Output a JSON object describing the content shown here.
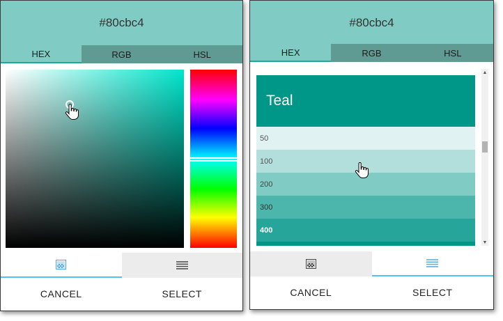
{
  "left_dialog": {
    "hex_value": "#80cbc4",
    "tabs": [
      {
        "label": "HEX"
      },
      {
        "label": "RGB"
      },
      {
        "label": "HSL"
      }
    ],
    "active_tab": "HEX",
    "modes": [
      {
        "icon": "gradient-icon",
        "active": true
      },
      {
        "icon": "list-icon",
        "active": false
      }
    ],
    "cancel_label": "CANCEL",
    "select_label": "SELECT"
  },
  "right_dialog": {
    "hex_value": "#80cbc4",
    "tabs": [
      {
        "label": "HEX"
      },
      {
        "label": "RGB"
      },
      {
        "label": "HSL"
      }
    ],
    "active_tab": "HEX",
    "palette": {
      "name": "Teal",
      "header_color": "#009688",
      "shades": [
        {
          "label": "50",
          "color": "#e0f2f1",
          "text": "#555555"
        },
        {
          "label": "100",
          "color": "#b2dfdb",
          "text": "#555555"
        },
        {
          "label": "200",
          "color": "#80cbc4",
          "text": "#444444"
        },
        {
          "label": "300",
          "color": "#4db6ac",
          "text": "#333333"
        },
        {
          "label": "400",
          "color": "#26a69a",
          "text": "#ffffff"
        },
        {
          "label": "",
          "color": "#009688",
          "text": "#ffffff"
        }
      ]
    },
    "modes": [
      {
        "icon": "gradient-icon",
        "active": false
      },
      {
        "icon": "list-icon",
        "active": true
      }
    ],
    "cancel_label": "CANCEL",
    "select_label": "SELECT"
  },
  "colors": {
    "accent": "#80cbc4",
    "tab_inactive": "#5f9a93",
    "active_indicator": "#4fc3f7"
  }
}
